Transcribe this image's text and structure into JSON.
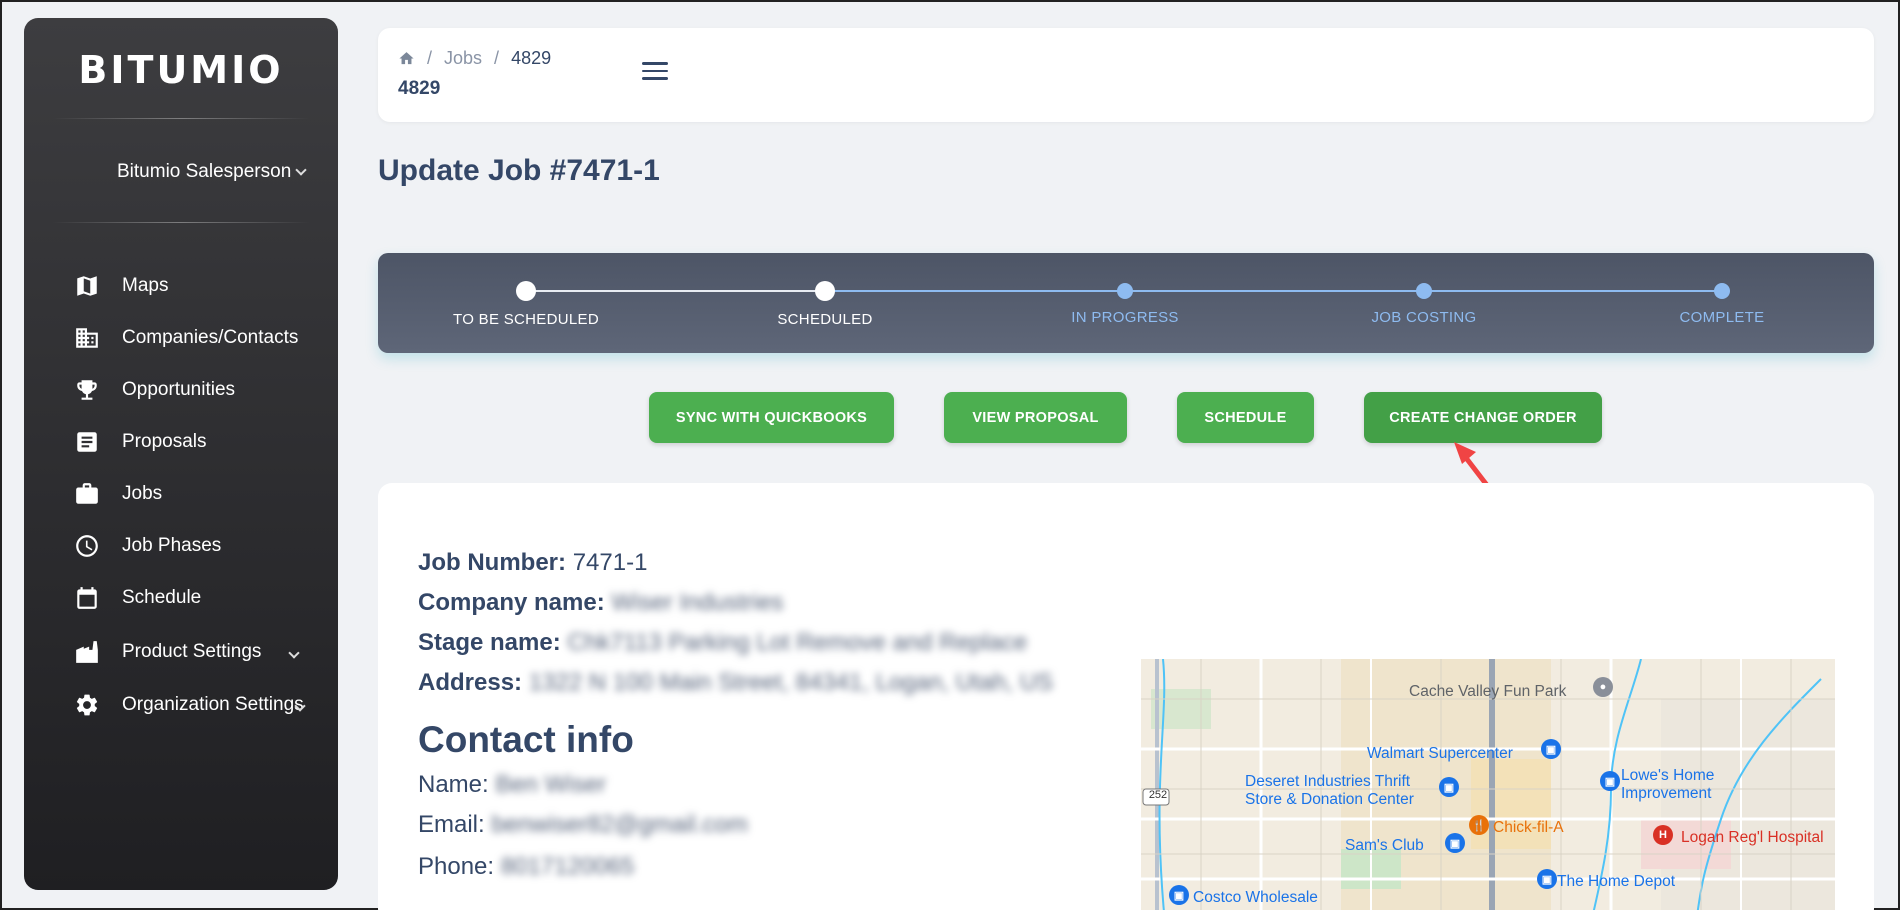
{
  "sidebar": {
    "brand": "BITUMIO",
    "user": "Bitumio Salesperson",
    "items": [
      {
        "label": "Maps",
        "icon": "map-icon"
      },
      {
        "label": "Companies/Contacts",
        "icon": "building-icon"
      },
      {
        "label": "Opportunities",
        "icon": "trophy-icon"
      },
      {
        "label": "Proposals",
        "icon": "document-icon"
      },
      {
        "label": "Jobs",
        "icon": "briefcase-icon"
      },
      {
        "label": "Job Phases",
        "icon": "clock-icon"
      },
      {
        "label": "Schedule",
        "icon": "calendar-icon"
      },
      {
        "label": "Product Settings",
        "icon": "factory-icon"
      },
      {
        "label": "Organization Settings",
        "icon": "gear-icon"
      }
    ]
  },
  "header": {
    "breadcrumb": {
      "home_icon": "home-icon",
      "jobs": "Jobs",
      "current": "4829",
      "separator": "/"
    },
    "title": "4829"
  },
  "page_title": "Update Job #7471-1",
  "stepper": {
    "steps": [
      {
        "label": "TO BE SCHEDULED",
        "state": "done"
      },
      {
        "label": "SCHEDULED",
        "state": "done"
      },
      {
        "label": "IN PROGRESS",
        "state": "todo"
      },
      {
        "label": "JOB COSTING",
        "state": "todo"
      },
      {
        "label": "COMPLETE",
        "state": "todo"
      }
    ]
  },
  "actions": {
    "sync": "SYNC WITH QUICKBOOKS",
    "view_proposal": "VIEW PROPOSAL",
    "schedule": "SCHEDULE",
    "change_order": "CREATE CHANGE ORDER"
  },
  "job": {
    "job_number_label": "Job Number:",
    "job_number": "7471-1",
    "company_label": "Company name:",
    "company": "Wiser Industries",
    "stage_label": "Stage name:",
    "stage": "Chk7113 Parking Lot Remove and Replace",
    "address_label": "Address:",
    "address": "1322 N 100 Main Street, 84341, Logan, Utah, US"
  },
  "contact": {
    "heading": "Contact info",
    "name_label": "Name:",
    "name": "Ben Wiser",
    "email_label": "Email:",
    "email": "benwiser82@gmail.com",
    "phone_label": "Phone:",
    "phone": "8017120065"
  },
  "map": {
    "places": [
      "Cache Valley Fun Park",
      "Walmart Supercenter",
      "Deseret Industries Thrift",
      "Store & Donation Center",
      "Lowe's Home",
      "Improvement",
      "Chick-fil-A",
      "Sam's Club",
      "Logan Reg'l Hospital",
      "The Home Depot",
      "Costco Wholesale",
      "252"
    ],
    "colors": {
      "shop": "#1a73e8",
      "food": "#e8710a",
      "hospital": "#d93025",
      "road": "#9aa5b4",
      "water": "#4fc3f7"
    }
  }
}
